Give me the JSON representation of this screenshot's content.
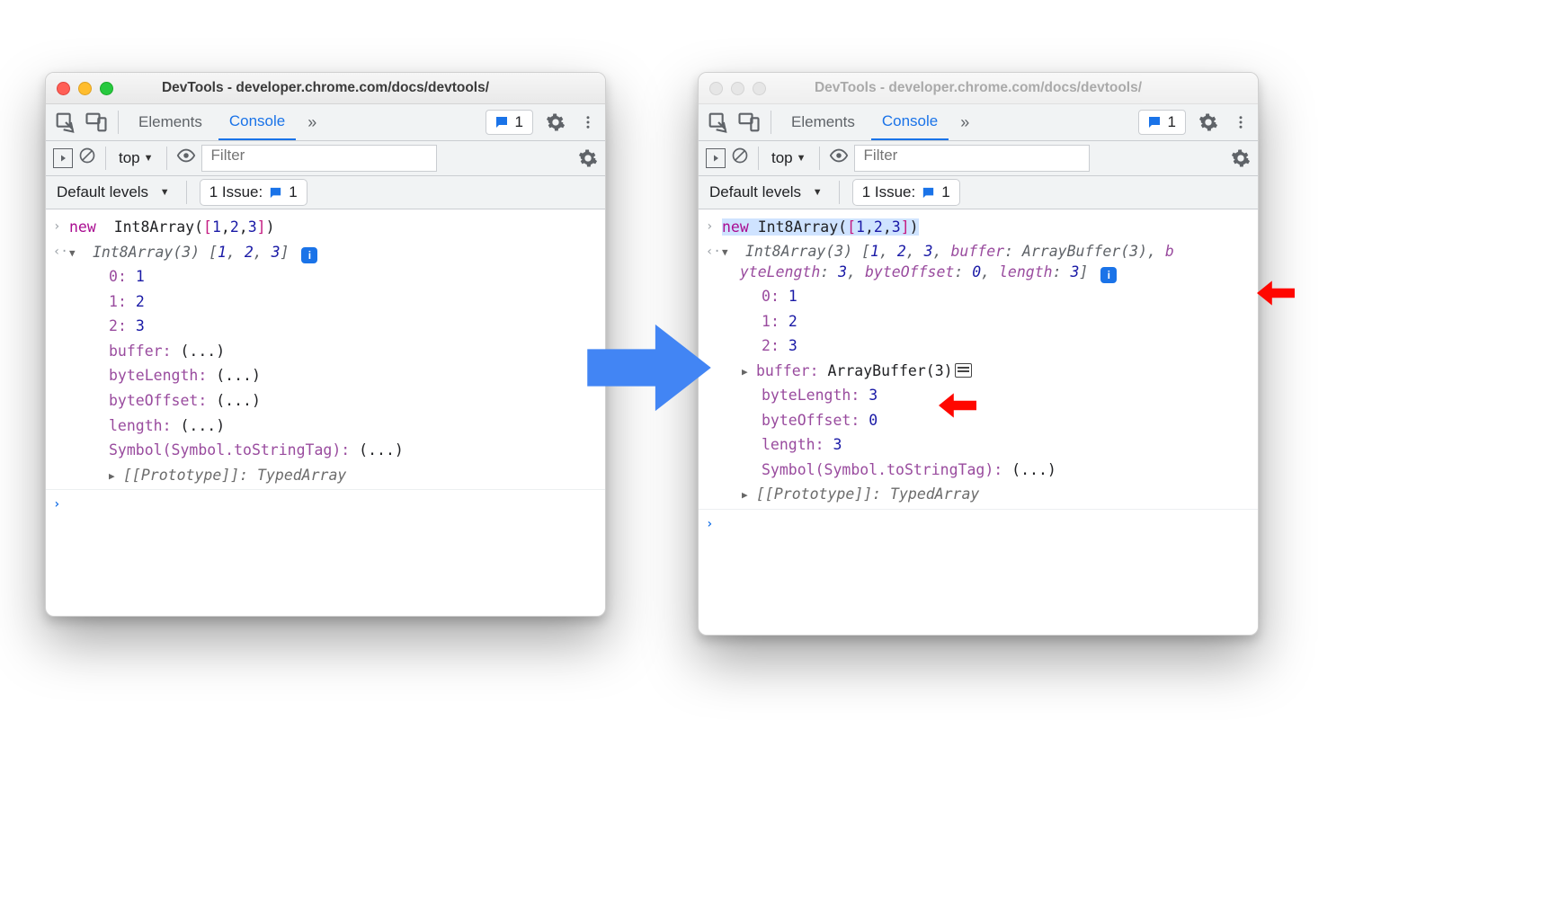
{
  "windows": {
    "title": "DevTools - developer.chrome.com/docs/devtools/",
    "tabs": {
      "elements": "Elements",
      "console": "Console"
    },
    "toolbar": {
      "issue_count": "1",
      "top_label": "top",
      "filter_placeholder": "Filter",
      "levels_label": "Default levels",
      "issue_label": "1 Issue:",
      "issue_chip": "1"
    }
  },
  "left": {
    "input": "new Int8Array([1,2,3])",
    "preview_type": "Int8Array(3)",
    "preview_values": "[1, 2, 3]",
    "entries": [
      {
        "k": "0",
        "v": "1"
      },
      {
        "k": "1",
        "v": "2"
      },
      {
        "k": "2",
        "v": "3"
      }
    ],
    "lazy": [
      "buffer",
      "byteLength",
      "byteOffset",
      "length"
    ],
    "symbol_key": "Symbol(Symbol.toStringTag)",
    "symbol_val": "(...)",
    "proto_key": "[[Prototype]]",
    "proto_val": "TypedArray"
  },
  "right": {
    "input": "new Int8Array([1,2,3])",
    "preview_line1": "Int8Array(3) [1, 2, 3, buffer: ArrayBuffer(3), b",
    "preview_line2": "yteLength: 3, byteOffset: 0, length: 3]",
    "entries": [
      {
        "k": "0",
        "v": "1"
      },
      {
        "k": "1",
        "v": "2"
      },
      {
        "k": "2",
        "v": "3"
      }
    ],
    "buffer_label": "buffer",
    "buffer_val": "ArrayBuffer(3)",
    "props": [
      {
        "k": "byteLength",
        "v": "3"
      },
      {
        "k": "byteOffset",
        "v": "0"
      },
      {
        "k": "length",
        "v": "3"
      }
    ],
    "symbol_key": "Symbol(Symbol.toStringTag)",
    "symbol_val": "(...)",
    "proto_key": "[[Prototype]]",
    "proto_val": "TypedArray"
  }
}
